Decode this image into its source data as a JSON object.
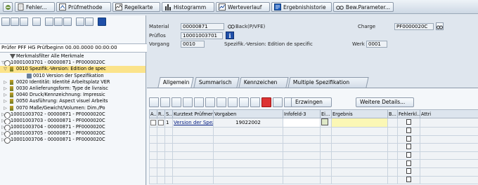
{
  "toolbar": {
    "buttons": [
      {
        "label": "",
        "icon": "back-icon"
      },
      {
        "label": "Fehler...",
        "icon": "document-icon"
      },
      {
        "label": "Prüfmethode",
        "icon": "method-icon"
      },
      {
        "label": "Regelkarte",
        "icon": "control-chart-icon"
      },
      {
        "label": "Histogramm",
        "icon": "histogram-icon"
      },
      {
        "label": "Werteverlauf",
        "icon": "value-trend-icon"
      },
      {
        "label": "Ergebnishistorie",
        "icon": "history-icon"
      },
      {
        "label": "Bew.Parameter...",
        "icon": "glasses-icon"
      }
    ]
  },
  "left": {
    "prufer": "Prüfer PFF HG Prüfbeginn 00.00.0000 00:00:00",
    "tree": [
      {
        "text": "Merkmalsfilter Alle Merkmale",
        "indent": 10,
        "expander": "",
        "icon": "filter-icon",
        "selected": false
      },
      {
        "text": "10001003701 - 00000871 - PF0000020C",
        "indent": 2,
        "expander": "▽",
        "icon": "lot-icon",
        "selected": false
      },
      {
        "text": "0010 Spezifik.-Version: Edition de spec",
        "indent": 10,
        "expander": "▽",
        "icon": "characteristic-icon",
        "selected": true
      },
      {
        "text": "0010 Version der Spezifikation",
        "indent": 34,
        "expander": "",
        "icon": "version-icon",
        "selected": false
      },
      {
        "text": "0020 Identität: Identité Arbeitsplatz VER",
        "indent": 10,
        "expander": "▷",
        "icon": "characteristic-icon",
        "selected": false
      },
      {
        "text": "0030 Anlieferungsform: Type de livraisc",
        "indent": 10,
        "expander": "▷",
        "icon": "characteristic-icon",
        "selected": false
      },
      {
        "text": "0040 Druck/Kennzeichnung: Impressic",
        "indent": 10,
        "expander": "▷",
        "icon": "characteristic-icon",
        "selected": false
      },
      {
        "text": "0050 Ausführung: Aspect visuel Arbeits",
        "indent": 10,
        "expander": "▷",
        "icon": "characteristic-icon",
        "selected": false
      },
      {
        "text": "0070 Maße/Gewicht/Volumen: Dim./Po",
        "indent": 10,
        "expander": "▷",
        "icon": "characteristic-icon",
        "selected": false
      },
      {
        "text": "10001003702 - 00000871 - PF0000020C",
        "indent": 2,
        "expander": "▷",
        "icon": "lot-icon",
        "selected": false
      },
      {
        "text": "10001003703 - 00000871 - PF0000020C",
        "indent": 2,
        "expander": "▷",
        "icon": "lot-icon",
        "selected": false
      },
      {
        "text": "10001003704 - 00000871 - PF0000020C",
        "indent": 2,
        "expander": "▷",
        "icon": "lot-icon",
        "selected": false
      },
      {
        "text": "10001003705 - 00000871 - PF0000020C",
        "indent": 2,
        "expander": "▷",
        "icon": "lot-icon",
        "selected": false
      },
      {
        "text": "10001003706 - 00000871 - PF0000020C",
        "indent": 2,
        "expander": "▷",
        "icon": "lot-icon",
        "selected": false
      }
    ]
  },
  "header": {
    "material_label": "Material",
    "material_value": "00000871",
    "back_label": "Back(P/VFE)",
    "charge_label": "Charge",
    "charge_value": "PF0000020C",
    "prueflos_label": "Prüflos",
    "prueflos_value": "10001003701",
    "vorgang_label": "Vorgang",
    "vorgang_value": "0010",
    "spezifik_text": "Spezifik.-Version: Edition de specific",
    "werk_label": "Werk",
    "werk_value": "0001"
  },
  "tabs": [
    "Allgemein",
    "Summarisch",
    "Kennzeichen",
    "Multiple Spezifikation"
  ],
  "grid": {
    "erzwingen_label": "Erzwingen",
    "weitere_label": "Weitere Details...",
    "columns": [
      "A...",
      "R...",
      "S...",
      "Kurztext Prüfmerkmal",
      "Vorgaben",
      "Infofeld-3",
      "Ei...",
      "Ergebnis",
      "B...",
      "Fehlerkl...",
      "Attri"
    ],
    "row1": {
      "num": "1",
      "kurztext": "Version der Spezifika...",
      "vorgaben": "19022002"
    }
  }
}
